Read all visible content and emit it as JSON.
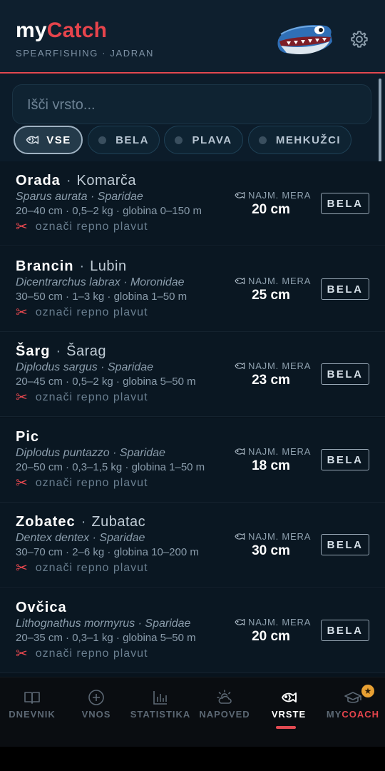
{
  "app": {
    "logo_my": "my",
    "logo_catch": "Catch",
    "subtitle": "SPEARFISHING · JADRAN"
  },
  "search": {
    "placeholder": "Išči vrsto..."
  },
  "filters": [
    {
      "label": "VSE",
      "active": true
    },
    {
      "label": "BELA",
      "active": false
    },
    {
      "label": "PLAVA",
      "active": false
    },
    {
      "label": "MEHKUŽCI",
      "active": false
    }
  ],
  "species_common": {
    "min_label": "NAJM. MERA",
    "mark_label": "označi repno plavut"
  },
  "species": [
    {
      "name": "Orada",
      "local": "Komarča",
      "latin": "Sparus aurata · Sparidae",
      "meta": "20–40 cm · 0,5–2 kg · globina 0–150 m",
      "min_size": "20 cm",
      "badge": "BELA"
    },
    {
      "name": "Brancin",
      "local": "Lubin",
      "latin": "Dicentrarchus labrax · Moronidae",
      "meta": "30–50 cm · 1–3 kg · globina 1–50 m",
      "min_size": "25 cm",
      "badge": "BELA"
    },
    {
      "name": "Šarg",
      "local": "Šarag",
      "latin": "Diplodus sargus · Sparidae",
      "meta": "20–45 cm · 0,5–2 kg · globina 5–50 m",
      "min_size": "23 cm",
      "badge": "BELA"
    },
    {
      "name": "Pic",
      "local": "",
      "latin": "Diplodus puntazzo · Sparidae",
      "meta": "20–50 cm · 0,3–1,5 kg · globina 1–50 m",
      "min_size": "18 cm",
      "badge": "BELA"
    },
    {
      "name": "Zobatec",
      "local": "Zubatac",
      "latin": "Dentex dentex · Sparidae",
      "meta": "30–70 cm · 2–6 kg · globina 10–200 m",
      "min_size": "30 cm",
      "badge": "BELA"
    },
    {
      "name": "Ovčica",
      "local": "",
      "latin": "Lithognathus mormyrus · Sparidae",
      "meta": "20–35 cm · 0,3–1 kg · globina 5–50 m",
      "min_size": "20 cm",
      "badge": "BELA"
    }
  ],
  "tabs": [
    {
      "label": "DNEVNIK",
      "icon": "book-icon"
    },
    {
      "label": "VNOS",
      "icon": "plus-circle-icon"
    },
    {
      "label": "STATISTIKA",
      "icon": "bar-chart-icon"
    },
    {
      "label": "NAPOVED",
      "icon": "weather-icon"
    },
    {
      "label": "VRSTE",
      "icon": "fish-icon",
      "active": true
    },
    {
      "label_my": "MY",
      "label_coach": "COACH",
      "icon": "graduation-cap-icon",
      "badge": "★"
    }
  ],
  "colors": {
    "accent": "#e24a52",
    "background": "#08131d",
    "header": "#0e1f2e"
  }
}
